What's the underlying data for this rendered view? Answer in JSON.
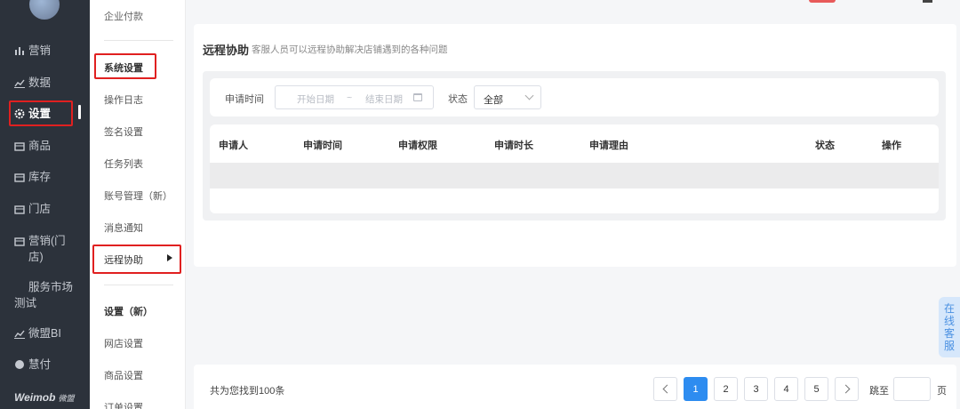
{
  "sidebar": {
    "items": [
      {
        "label": "营销",
        "icon": "bar-chart-icon"
      },
      {
        "label": "数据",
        "icon": "line-chart-icon"
      },
      {
        "label": "设置",
        "icon": "gear-icon"
      },
      {
        "label": "商品",
        "icon": "box-icon"
      },
      {
        "label": "库存",
        "icon": "box-icon"
      },
      {
        "label": "门店",
        "icon": "box-icon"
      },
      {
        "label": "营销(门店)",
        "icon": "box-icon"
      },
      {
        "label": "服务市场测试",
        "icon": ""
      },
      {
        "label": "微盟BI",
        "icon": "line-chart-icon"
      },
      {
        "label": "慧付",
        "icon": "circle-icon"
      }
    ],
    "brand": "Weimob",
    "brand_cn": "微盟"
  },
  "submenu": {
    "top_item": "企业付款",
    "section1_title": "系统设置",
    "items1": [
      "操作日志",
      "签名设置",
      "任务列表",
      "账号管理（新）",
      "消息通知",
      "远程协助"
    ],
    "section2_title": "设置（新）",
    "items2": [
      "网店设置",
      "商品设置",
      "订单设置"
    ]
  },
  "main": {
    "title": "远程协助",
    "subtitle": "客服人员可以远程协助解决店铺遇到的各种问题",
    "filter": {
      "time_label": "申请时间",
      "start_placeholder": "开始日期",
      "separator": "~",
      "end_placeholder": "结束日期",
      "status_label": "状态",
      "status_value": "全部"
    },
    "table": {
      "columns": [
        "申请人",
        "申请时间",
        "申请权限",
        "申请时长",
        "申请理由",
        "状态",
        "操作"
      ]
    }
  },
  "pagination": {
    "total_text": "共为您找到100条",
    "pages": [
      "1",
      "2",
      "3",
      "4",
      "5"
    ],
    "current": "1",
    "jump_label": "跳至",
    "page_unit": "页"
  },
  "float_service": "在线客服"
}
